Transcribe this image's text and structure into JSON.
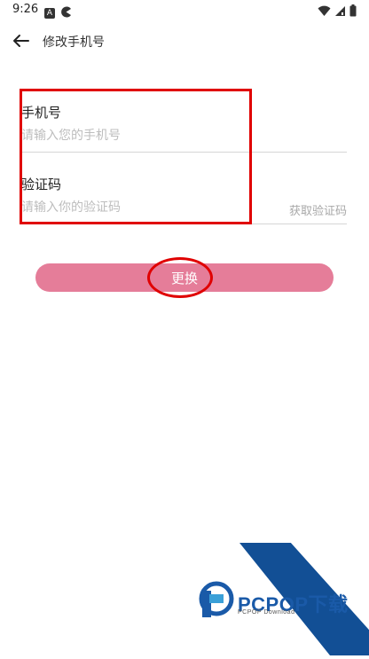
{
  "status_bar": {
    "time": "9:26",
    "left_icons": [
      "notification-a-icon",
      "pacman-icon"
    ],
    "right_icons": [
      "wifi-icon",
      "signal-icon",
      "battery-icon"
    ]
  },
  "header": {
    "title": "修改手机号",
    "back_icon": "back-arrow-icon"
  },
  "form": {
    "phone": {
      "label": "手机号",
      "placeholder": "请输入您的手机号",
      "value": ""
    },
    "code": {
      "label": "验证码",
      "placeholder": "请输入你的验证码",
      "value": "",
      "get_code_label": "获取验证码"
    },
    "submit_label": "更换"
  },
  "colors": {
    "button_bg": "#e57d99",
    "annotation": "#e00000",
    "watermark_blue": "#1a5aa8"
  },
  "watermark": {
    "brand": "PCPOP下载",
    "sub": "PCPOP Download"
  }
}
